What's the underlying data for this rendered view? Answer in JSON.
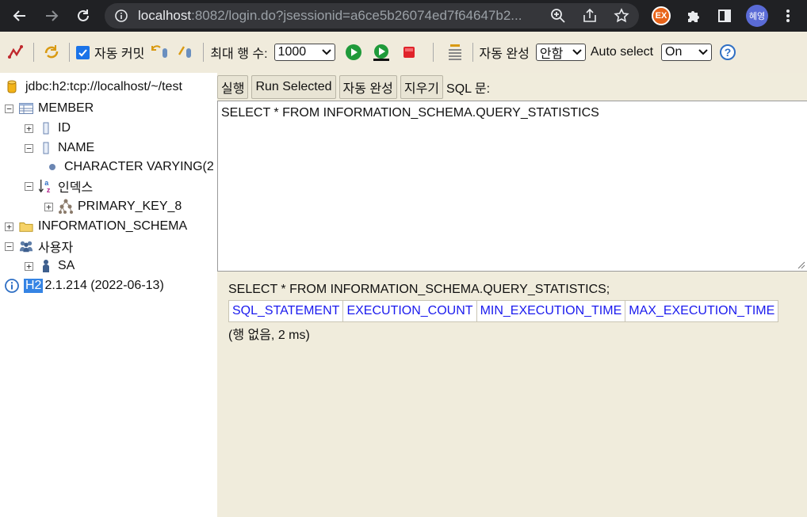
{
  "browser": {
    "url_host": "localhost",
    "url_rest": ":8082/login.do?jsessionid=a6ce5b26074ed7f64647b2...",
    "extension_badge": "EX",
    "profile_label": "혜영"
  },
  "toolbar": {
    "auto_commit_label": "자동 커밋",
    "max_rows_label": "최대 행 수:",
    "max_rows_value": "1000",
    "autocomplete_label": "자동 완성",
    "autocomplete_value": "안함",
    "auto_select_label": "Auto select",
    "auto_select_value": "On",
    "help_label": "?"
  },
  "tree": {
    "connection": "jdbc:h2:tcp://localhost/~/test",
    "table_member": "MEMBER",
    "col_id": "ID",
    "col_name": "NAME",
    "col_name_type": "CHARACTER VARYING(2",
    "indexes": "인덱스",
    "primary_key": "PRIMARY_KEY_8",
    "info_schema": "INFORMATION_SCHEMA",
    "users": "사용자",
    "user_sa": "SA",
    "h2_badge": "H2",
    "version": "2.1.214 (2022-06-13)"
  },
  "query_bar": {
    "run": "실행",
    "run_selected": "Run Selected",
    "autocomplete": "자동 완성",
    "clear": "지우기",
    "sql_label": "SQL 문:"
  },
  "editor": {
    "text": "SELECT * FROM INFORMATION_SCHEMA.QUERY_STATISTICS"
  },
  "result": {
    "statement": "SELECT * FROM INFORMATION_SCHEMA.QUERY_STATISTICS;",
    "columns": [
      "SQL_STATEMENT",
      "EXECUTION_COUNT",
      "MIN_EXECUTION_TIME",
      "MAX_EXECUTION_TIME"
    ],
    "footer": "(행 없음, 2 ms)"
  }
}
